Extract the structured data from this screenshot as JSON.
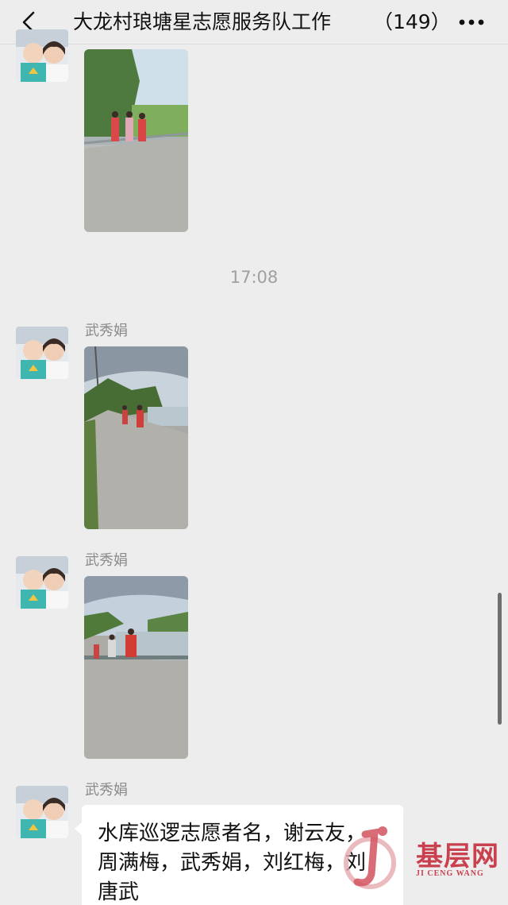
{
  "header": {
    "title": "大龙村琅塘星志愿服务队工作",
    "member_count": "（149）",
    "back_icon": "chevron-left-icon",
    "more_icon": "more-dots-icon"
  },
  "timestamp": "17:08",
  "messages": [
    {
      "sender": "",
      "type": "image"
    },
    {
      "sender": "武秀娟",
      "type": "image"
    },
    {
      "sender": "武秀娟",
      "type": "image"
    },
    {
      "sender": "武秀娟",
      "type": "text",
      "lines": [
        "水库巡逻志愿者名，谢云友，",
        "周满梅，武秀娟，刘红梅，刘",
        "唐武"
      ]
    }
  ],
  "watermark": {
    "main": "基层网",
    "sub": "JI CENG WANG"
  },
  "colors": {
    "background": "#ededed",
    "bubble": "#ffffff",
    "watermark": "#c9414f",
    "sender": "#8a8a8a"
  }
}
